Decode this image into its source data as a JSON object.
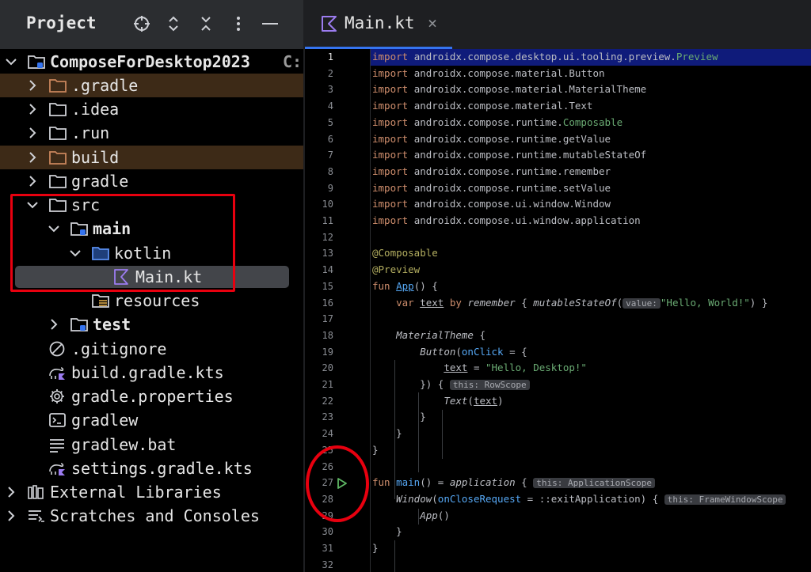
{
  "project_panel": {
    "title": "Project",
    "header_icons": [
      "target-icon",
      "expand-collapse-icon",
      "collapse-all-icon",
      "more-options-icon",
      "minimize-icon"
    ],
    "tree": [
      {
        "label": "ComposeForDesktop2023",
        "suffix": "C:",
        "icon": "module-folder-icon",
        "expanded": true
      },
      {
        "label": ".gradle",
        "icon": "folder-icon",
        "excluded": true
      },
      {
        "label": ".idea",
        "icon": "folder-icon"
      },
      {
        "label": ".run",
        "icon": "folder-icon"
      },
      {
        "label": "build",
        "icon": "folder-icon",
        "excluded": true
      },
      {
        "label": "gradle",
        "icon": "folder-icon"
      },
      {
        "label": "src",
        "icon": "folder-icon",
        "expanded": true
      },
      {
        "label": "main",
        "icon": "module-folder-icon",
        "expanded": true
      },
      {
        "label": "kotlin",
        "icon": "source-folder-icon",
        "expanded": true
      },
      {
        "label": "Main.kt",
        "icon": "kotlin-file-icon",
        "selected": true
      },
      {
        "label": "resources",
        "icon": "resources-folder-icon"
      },
      {
        "label": "test",
        "icon": "module-folder-icon"
      },
      {
        "label": ".gitignore",
        "icon": "ignore-file-icon"
      },
      {
        "label": "build.gradle.kts",
        "icon": "gradle-kts-icon"
      },
      {
        "label": "gradle.properties",
        "icon": "settings-gear-icon"
      },
      {
        "label": "gradlew",
        "icon": "terminal-icon"
      },
      {
        "label": "gradlew.bat",
        "icon": "text-file-icon"
      },
      {
        "label": "settings.gradle.kts",
        "icon": "gradle-kts-icon"
      },
      {
        "label": "External Libraries",
        "icon": "libraries-icon"
      },
      {
        "label": "Scratches and Consoles",
        "icon": "scratches-icon"
      }
    ]
  },
  "editor": {
    "tab": {
      "label": "Main.kt",
      "close": "×"
    },
    "current_line": 1,
    "line_numbers": [
      "1",
      "2",
      "3",
      "4",
      "5",
      "6",
      "7",
      "8",
      "9",
      "10",
      "11",
      "12",
      "13",
      "14",
      "15",
      "16",
      "17",
      "18",
      "19",
      "20",
      "21",
      "22",
      "23",
      "24",
      "25",
      "26",
      "27",
      "28",
      "29",
      "30",
      "31",
      "32"
    ],
    "code": {
      "l1_pkg": "androidx.compose.desktop.ui.tooling.preview.",
      "l1_cls": "Preview",
      "l2": "androidx.compose.material.Button",
      "l3": "androidx.compose.material.MaterialTheme",
      "l4": "androidx.compose.material.Text",
      "l5_pkg": "androidx.compose.runtime.",
      "l5_cls": "Composable",
      "l6": "androidx.compose.runtime.getValue",
      "l7": "androidx.compose.runtime.mutableStateOf",
      "l8": "androidx.compose.runtime.remember",
      "l9": "androidx.compose.runtime.setValue",
      "l10": "androidx.compose.ui.window.Window",
      "l11": "androidx.compose.ui.window.application",
      "import_kw": "import",
      "l13": "@Composable",
      "l14": "@Preview",
      "l15_kw": "fun",
      "l15_name": "App",
      "l15_rest": "() {",
      "l16_kw": "var",
      "l16_var": "text",
      "l16_by": "by",
      "l16_remember": "remember",
      "l16_brace": "{",
      "l16_fn": "mutableStateOf",
      "l16_hint": "value:",
      "l16_str": "\"Hello, World!\"",
      "l16_end": ") }",
      "l18_fn": "MaterialTheme",
      "l18_rest": " {",
      "l19_fn": "Button",
      "l19_param": "onClick",
      "l19_rest": " = {",
      "l20_var": "text",
      "l20_eq": " = ",
      "l20_str": "\"Hello, Desktop!\"",
      "l21_code": "}) {",
      "l21_hint": "this: RowScope",
      "l22_fn": "Text",
      "l22_arg": "text",
      "l23": "}",
      "l24": "}",
      "l25": "}",
      "l27_kw": "fun",
      "l27_name": "main",
      "l27_rest": "() = ",
      "l27_app": "application",
      "l27_brace": " {",
      "l27_hint": "this: ApplicationScope",
      "l28_fn": "Window",
      "l28_param": "onCloseRequest",
      "l28_eq": " = ",
      "l28_ref": "::exitApplication",
      "l28_brace": ") {",
      "l28_hint": "this: FrameWindowScope",
      "l29_fn": "App",
      "l29_rest": "()",
      "l30": "}",
      "l31": "}"
    }
  }
}
